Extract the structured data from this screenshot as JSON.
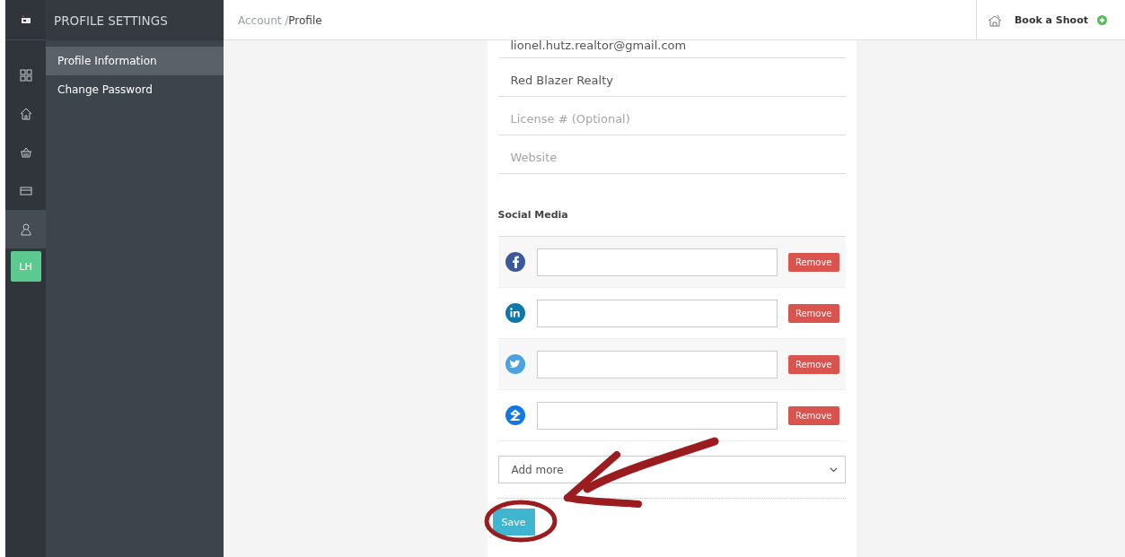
{
  "rail": {
    "avatar": "LH",
    "items": [
      {
        "kind": "grid",
        "selected": false
      },
      {
        "kind": "home",
        "selected": false
      },
      {
        "kind": "basket",
        "selected": false
      },
      {
        "kind": "card",
        "selected": false
      },
      {
        "kind": "user",
        "selected": true
      }
    ]
  },
  "submenu": {
    "title": "PROFILE SETTINGS",
    "items": [
      {
        "label": "Profile Information",
        "selected": true
      },
      {
        "label": "Change Password",
        "selected": false
      }
    ]
  },
  "breadcrumb": {
    "parent": "Account /",
    "current": "Profile"
  },
  "header_action": {
    "label": "Book a Shoot"
  },
  "fields": [
    {
      "value": "lionel.hutz.realtor@gmail.com"
    },
    {
      "value": "Red Blazer Realty"
    },
    {
      "placeholder": "License # (Optional)"
    },
    {
      "placeholder": "Website"
    }
  ],
  "social": {
    "title": "Social Media",
    "rows": [
      {
        "kind": "facebook",
        "button": "Remove"
      },
      {
        "kind": "linkedin",
        "button": "Remove"
      },
      {
        "kind": "twitter",
        "button": "Remove"
      },
      {
        "kind": "zillow",
        "button": "Remove"
      }
    ],
    "add_select": "Add more"
  },
  "save_button": "Save"
}
